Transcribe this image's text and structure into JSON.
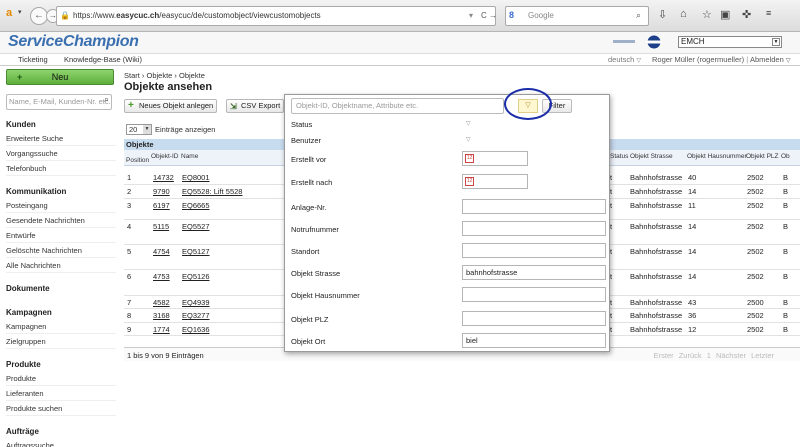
{
  "browser": {
    "url_prefix": "https://www.",
    "url_domain": "easycuc.ch",
    "url_path": "/easycuc/de/customobject/viewcustomobjects",
    "search_placeholder": "Google"
  },
  "app": {
    "logo": "ServiceChampion",
    "company": "EMCH",
    "menu": [
      "Ticketing",
      "Knowledge-Base (Wiki)"
    ],
    "language": "deutsch",
    "user": "Roger Müller (rogermueller)",
    "logout": "Abmelden"
  },
  "sidebar": {
    "new_button": "Neu",
    "search_placeholder": "Name, E-Mail, Kunden-Nr. etc.",
    "sections": [
      {
        "title": "Kunden",
        "items": [
          "Erweiterte Suche",
          "Vorgangssuche",
          "Telefonbuch"
        ]
      },
      {
        "title": "Kommunikation",
        "items": [
          "Posteingang",
          "Gesendete Nachrichten",
          "Entwürfe",
          "Gelöschte Nachrichten",
          "Alle Nachrichten"
        ]
      },
      {
        "title": "Dokumente",
        "items": []
      },
      {
        "title": "Kampagnen",
        "items": [
          "Kampagnen",
          "Zielgruppen"
        ]
      },
      {
        "title": "Produkte",
        "items": [
          "Produkte",
          "Lieferanten",
          "Produkte suchen"
        ]
      },
      {
        "title": "Aufträge",
        "items": [
          "Auftragssuche"
        ]
      }
    ]
  },
  "main": {
    "breadcrumb": "Start › Objekte › Objekte",
    "title": "Objekte ansehen",
    "new_object_button": "Neues Objekt anlegen",
    "csv_button": "CSV Export",
    "entries_value": "20",
    "entries_label": "Einträge anzeigen",
    "table_caption": "Objekte",
    "columns": [
      "Position",
      "Objekt-ID",
      "Name",
      "Status",
      "Objekt Strasse",
      "Objekt Hausnummer",
      "Objekt PLZ",
      "Ob"
    ],
    "rows": [
      {
        "pos": "1",
        "id": "14732",
        "name": "EQ8001",
        "status": "t",
        "street": "Bahnhofstrasse",
        "nr": "40",
        "plz": "2502",
        "ort": "B"
      },
      {
        "pos": "2",
        "id": "9790",
        "name": "EQ5528: Lift 5528",
        "status": "t",
        "street": "Bahnhofstrasse",
        "nr": "14",
        "plz": "2502",
        "ort": "B"
      },
      {
        "pos": "3",
        "id": "6197",
        "name": "EQ6665",
        "status": "t",
        "street": "Bahnhofstrasse",
        "nr": "11",
        "plz": "2502",
        "ort": "B"
      },
      {
        "pos": "4",
        "id": "5115",
        "name": "EQ5527",
        "status": "t",
        "street": "Bahnhofstrasse",
        "nr": "14",
        "plz": "2502",
        "ort": "B"
      },
      {
        "pos": "5",
        "id": "4754",
        "name": "EQ5127",
        "status": "t",
        "street": "Bahnhofstrasse",
        "nr": "14",
        "plz": "2502",
        "ort": "B"
      },
      {
        "pos": "6",
        "id": "4753",
        "name": "EQ5126",
        "status": "t",
        "street": "Bahnhofstrasse",
        "nr": "14",
        "plz": "2502",
        "ort": "B"
      },
      {
        "pos": "7",
        "id": "4582",
        "name": "EQ4939",
        "status": "t",
        "street": "Bahnhofstrasse",
        "nr": "43",
        "plz": "2500",
        "ort": "B"
      },
      {
        "pos": "8",
        "id": "3168",
        "name": "EQ3277",
        "status": "t",
        "street": "Bahnhofstrasse",
        "nr": "36",
        "plz": "2502",
        "ort": "B"
      },
      {
        "pos": "9",
        "id": "1774",
        "name": "EQ1636",
        "status": "t",
        "street": "Bahnhofstrasse",
        "nr": "12",
        "plz": "2502",
        "ort": "B"
      }
    ],
    "footer_info": "1 bis 9 von 9 Einträgen",
    "pagination": "Erster Zurück 1 Nächster Letzter"
  },
  "filter": {
    "search_placeholder": "Objekt-ID, Objektname, Attribute etc.",
    "filter_button": "Filter",
    "fields": [
      {
        "label": "Status",
        "type": "dropdown",
        "value": ""
      },
      {
        "label": "Benutzer",
        "type": "dropdown",
        "value": ""
      },
      {
        "label": "Erstellt vor",
        "type": "date",
        "value": ""
      },
      {
        "label": "Erstellt nach",
        "type": "date",
        "value": ""
      },
      {
        "label": "Anlage-Nr.",
        "type": "text",
        "value": ""
      },
      {
        "label": "Notrufnummer",
        "type": "text",
        "value": ""
      },
      {
        "label": "Standort",
        "type": "text",
        "value": ""
      },
      {
        "label": "Objekt Strasse",
        "type": "text",
        "value": "bahnhofstrasse"
      },
      {
        "label": "Objekt Hausnummer",
        "type": "text",
        "value": ""
      },
      {
        "label": "Objekt PLZ",
        "type": "text",
        "value": ""
      },
      {
        "label": "Objekt Ort",
        "type": "text",
        "value": "biel"
      }
    ]
  },
  "colors": {
    "accent": "#3a6fb0",
    "new_button": "#6dbb48",
    "annotation_circle": "#1b2da8"
  }
}
